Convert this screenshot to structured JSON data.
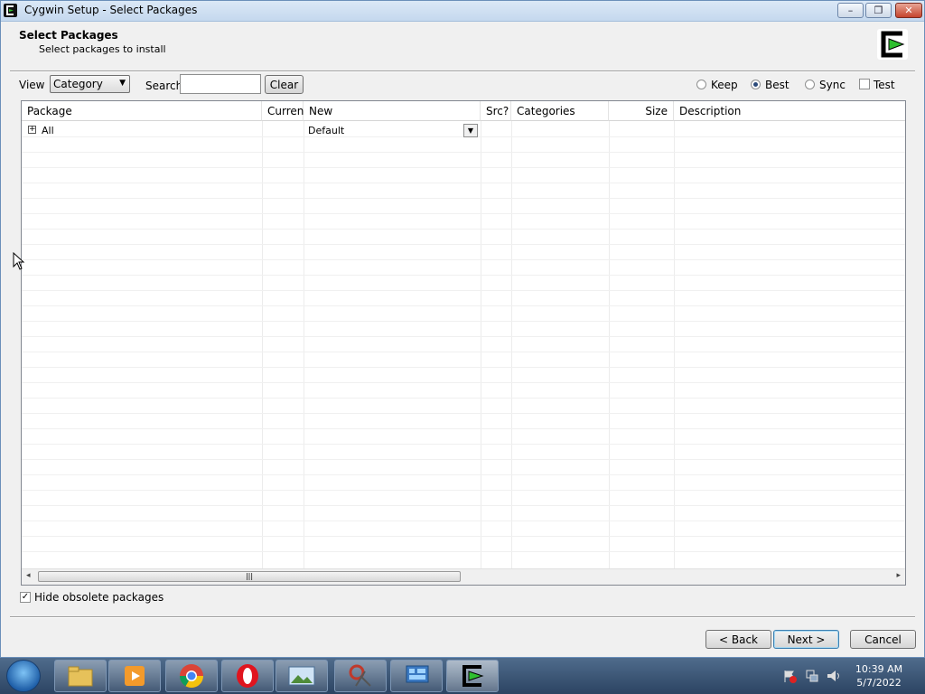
{
  "window": {
    "title": "Cygwin Setup - Select Packages",
    "controls": {
      "minimize": "▭",
      "maximize": "🗗",
      "close": "✕"
    }
  },
  "header": {
    "title": "Select Packages",
    "subtitle": "Select packages to install"
  },
  "toolbar": {
    "view_label": "View",
    "view_selected": "Category",
    "search_label": "Search",
    "search_value": "",
    "clear_label": "Clear",
    "modes": [
      {
        "label": "Keep",
        "selected": false
      },
      {
        "label": "Best",
        "selected": true
      },
      {
        "label": "Sync",
        "selected": false
      }
    ],
    "test_label": "Test",
    "test_checked": false
  },
  "table": {
    "columns": [
      "Package",
      "Current",
      "New",
      "Src?",
      "Categories",
      "Size",
      "Description"
    ],
    "rows": [
      {
        "package": "All",
        "current": "",
        "new": "Default",
        "src": "",
        "categories": "",
        "size": "",
        "description": ""
      }
    ]
  },
  "footer": {
    "hide_obsolete_label": "Hide obsolete packages",
    "hide_obsolete_checked": true,
    "back_label": "< Back",
    "next_label": "Next >",
    "cancel_label": "Cancel"
  },
  "taskbar": {
    "apps": [
      "file-explorer-icon",
      "media-player-icon",
      "chrome-icon",
      "opera-icon",
      "image-viewer-icon",
      "snipping-tool-icon",
      "control-panel-icon",
      "cygwin-icon"
    ],
    "time": "10:39 AM",
    "date": "5/7/2022"
  },
  "colors": {
    "accent": "#3c7fb1",
    "cygwin_green": "#2fbf2f"
  }
}
